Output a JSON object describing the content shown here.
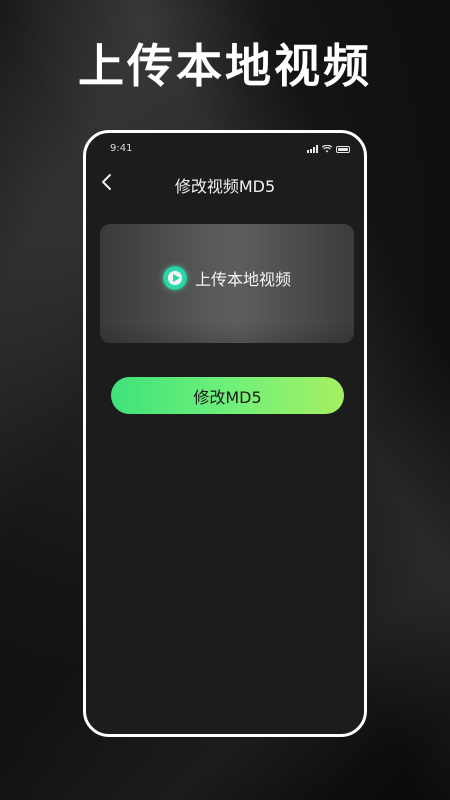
{
  "headline": "上传本地视频",
  "status_bar": {
    "time": "9:41",
    "icons": [
      "signal-icon",
      "wifi-icon",
      "battery-icon"
    ]
  },
  "nav": {
    "back_icon": "chevron-left-icon",
    "title": "修改视频MD5"
  },
  "upload_card": {
    "icon": "play-icon",
    "label": "上传本地视频"
  },
  "modify_button": {
    "label": "修改MD5"
  },
  "colors": {
    "accent_start": "#3fe27a",
    "accent_end": "#a6ef62",
    "phone_bg": "#1c1c1c",
    "play_icon": "#2bd4a6"
  }
}
